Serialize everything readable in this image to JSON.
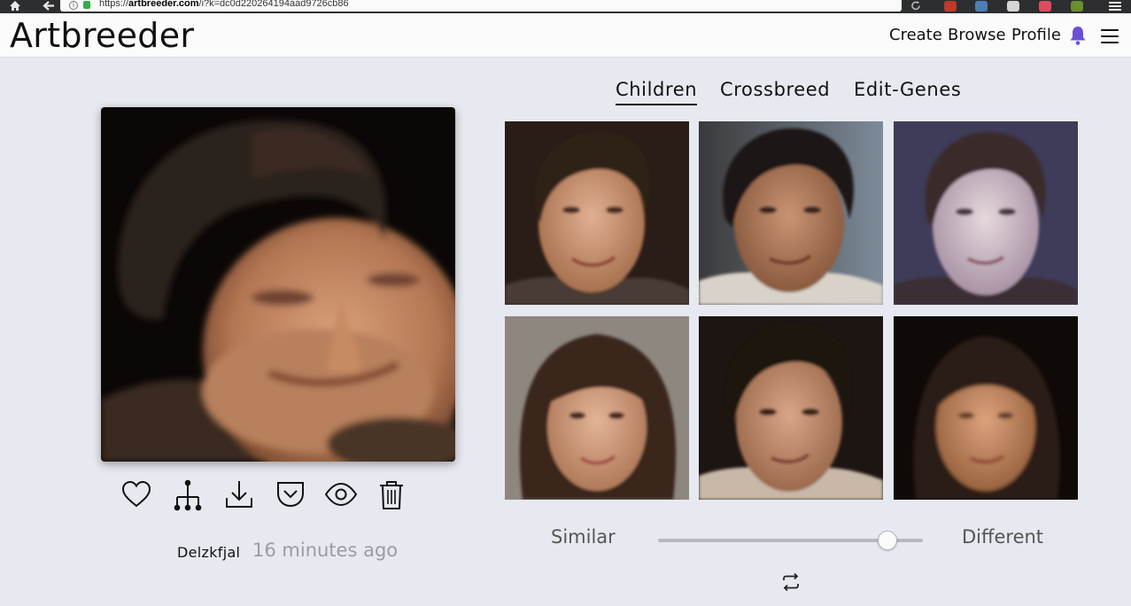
{
  "browser": {
    "url_prefix": "https://",
    "url_domain": "artbreeder.com",
    "url_path": "/i?k=dc0d220264194aad9726cb86"
  },
  "header": {
    "logo": "Artbreeder",
    "nav": [
      {
        "label": "Create"
      },
      {
        "label": "Browse"
      },
      {
        "label": "Profile"
      }
    ]
  },
  "tabs": [
    {
      "label": "Children",
      "active": true
    },
    {
      "label": "Crossbreed",
      "active": false
    },
    {
      "label": "Edit-Genes",
      "active": false
    }
  ],
  "image": {
    "author": "Delzkfjal",
    "timestamp": "16 minutes ago"
  },
  "actions": [
    "heart-icon",
    "family-tree-icon",
    "download-icon",
    "pocket-save-icon",
    "eye-icon",
    "trash-icon"
  ],
  "slider": {
    "left_label": "Similar",
    "right_label": "Different",
    "value": 0.87
  },
  "colors": {
    "accent_bell": "#6b4fd8",
    "background": "#e6e9ef"
  }
}
